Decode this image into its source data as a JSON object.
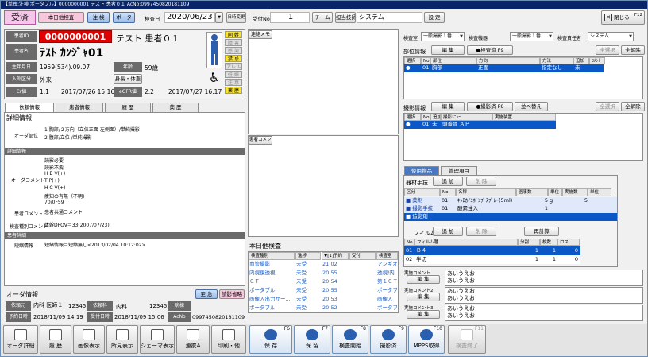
{
  "window": {
    "title": "【単独:注検 ポータブル】0000000001 テスト 患者０１ AcNo:0997450820181109"
  },
  "top": {
    "status": "受済",
    "mode": "本日他検査",
    "btn_chuken": "注 検",
    "btn_portable": "ポータ",
    "exam_date_label": "検査日",
    "exam_date": "2020/06/23",
    "date_change": "日時変更",
    "reception_label": "受付No",
    "reception_no": "1",
    "team": "チーム",
    "staff": "担当技師",
    "system": "システム",
    "settings": "設 定",
    "close": "閉じる",
    "close_key": "F12"
  },
  "patient": {
    "id_label": "患者ID",
    "id": "0000000001",
    "name_kanji": "テスト 患者０１",
    "name_label": "患者名",
    "name_kana": "ﾃｽﾄ ｶﾝｼﾞｬ01",
    "dob_label": "生年月日",
    "dob": "1959(S34).09.07",
    "age_label": "年齢",
    "age": "59歳",
    "admit_label": "入外区分",
    "admit": "外来",
    "body_btn": "身長・体重",
    "cr_label": "Cr値",
    "cr": "1.1",
    "cr_date": "2017/07/26 15:16",
    "egfr_label": "eGFR値",
    "egfr": "2.2",
    "egfr_date": "2017/07/27 16:17",
    "flags": [
      "同 姓",
      "障 害",
      "感 染",
      "禁 忌",
      "アレルギー",
      "妊 娠",
      "注 意",
      "薬 歴"
    ]
  },
  "tabs": {
    "t1": "依頼情報",
    "t2": "患者情報",
    "t3": "履 歴",
    "t4": "薬 歴"
  },
  "detail": {
    "title": "詳細情報",
    "order_site_label": "オーダ部位",
    "order_site_1": "1 胸部/２方向（立位正面-左側面）/単純撮影",
    "order_site_2": "2 腹部/立位 /単純撮影",
    "section1": "詳細情報",
    "order_comment_label": "オーダコメント",
    "order_comments": [
      "読影必要",
      "読影不要",
      "H B V(+)",
      "T P(+)",
      "H C V(+)",
      "痩知の有無（不明)",
      "70/0F59"
    ],
    "patient_comment_label": "患者コメント",
    "patient_comment": "患者共通コメント",
    "exam_comment_label": "検査種別コメント",
    "exam_comment": "体幹DFOV＝33(2007/07/23)",
    "section2": "患者詳細",
    "short_label": "短縮情報",
    "short_text": "短縮情報＝短縮無し<2013/02/04 10:12:02>"
  },
  "order_info": {
    "title": "オーダ情報",
    "urgent": "至 急",
    "reading": "読影省略",
    "req_dept_label": "依頼元",
    "req_dept": "内科 医師１",
    "req_doc_id": "12345",
    "req_ward_label": "依頼科",
    "req_ward": "内科",
    "req_ward_id": "12345",
    "ward_label": "病棟",
    "ward": "",
    "sched_label": "予約日時",
    "sched": "2018/11/09 14:19",
    "recv_label": "受付日時",
    "recv": "2018/11/09 15:06",
    "acno_label": "AcNo",
    "acno": "0997450820181109"
  },
  "middle": {
    "contact_memo": "連絡メモ",
    "patient_comment": "患者コメント",
    "other_exam_title": "本日他検査",
    "cols": [
      "検査種別",
      "進捗",
      "▼[1]予約",
      "受付",
      "検査室"
    ],
    "rows": [
      [
        "血管撮影",
        "未受",
        "21:02",
        "",
        "アンギオ"
      ],
      [
        "内視鏡透視",
        "未受",
        "20:55",
        "",
        "透視/内"
      ],
      [
        "ＣＴ",
        "未受",
        "20:54",
        "",
        "第１ＣＴ"
      ],
      [
        "ポータブル",
        "未受",
        "20:55",
        "",
        "ポータブ"
      ],
      [
        "画像入出力サー...",
        "未受",
        "20:53",
        "",
        "画像入"
      ],
      [
        "ポータブル",
        "未受",
        "20:52",
        "",
        "ポータブ"
      ]
    ]
  },
  "right": {
    "room_label": "検査室",
    "room": "一般撮影１番",
    "equip_label": "検査機器",
    "equip": "一般撮影１番",
    "resp_label": "検査責任者",
    "resp": "システム",
    "site_info": "部位情報",
    "edit": "編 集",
    "done": "●検査済 F9",
    "select_all": "全選択",
    "deselect_all": "全解除",
    "site_cols": [
      "選択",
      "No",
      "部位",
      "方向",
      "方法",
      "追加",
      "ｺﾒﾝﾄ"
    ],
    "site_row": [
      "●",
      "01",
      "胸部",
      "正面",
      "指定なし",
      "未",
      ""
    ],
    "shot_info": "撮影情報",
    "shot_done": "●撮影済 F9",
    "reorder": "並べ替え",
    "shot_cols": [
      "選択",
      "No",
      "追加",
      "撮影ﾒﾆｭｰ",
      "実施装置"
    ],
    "shot_row": [
      "●",
      "01",
      "未",
      "頭蓋骨 ＡＰ",
      ""
    ],
    "tab_goods": "使用物品",
    "tab_manage": "管理項目",
    "equip_material": "器材手技",
    "add": "追 加",
    "del": "削 除",
    "mat_cols": [
      "区分",
      "No",
      "名称",
      "医事数",
      "単位",
      "実施数",
      "単位"
    ],
    "mat_rows": [
      [
        "薬剤",
        "01",
        "ｷｼﾛｶｲﾝﾎﾟﾝﾌﾟｽﾌﾟﾚｰ(5ml)",
        "5",
        "g",
        "5",
        ""
      ],
      [
        "撮影手技",
        "01",
        "酸素注入",
        "1",
        "",
        "",
        ""
      ],
      [
        "造影剤",
        "",
        "",
        "",
        "",
        "",
        ""
      ]
    ],
    "film": "フィルム",
    "recalc": "再計算",
    "film_cols": [
      "No",
      "フィルム種",
      "分割",
      "枚数",
      "ロス"
    ],
    "film_rows": [
      [
        "01",
        "Ｂ４",
        "1",
        "1",
        "0"
      ],
      [
        "02",
        "半切",
        "1",
        "1",
        "0"
      ]
    ],
    "impl_comments": [
      {
        "label": "実施コメント",
        "text": "あいうえお\nあいうえお"
      },
      {
        "label": "実施コメント2",
        "text": "あいうえお\nあいうえお"
      },
      {
        "label": "実施コメント3",
        "text": "あいうえお\nあいうえお"
      }
    ]
  },
  "footer": {
    "b1": "オーダ詳細",
    "b2": "履 歴",
    "b3": "画像表示",
    "b4": "所見表示",
    "b5": "シェーマ表示",
    "b6": "連携A",
    "b7": "印刷・他",
    "save": "保 存",
    "save_key": "F6",
    "hold": "保 留",
    "hold_key": "F7",
    "start": "検査開始",
    "start_key": "F8",
    "shot": "撮影済",
    "shot_key": "F9",
    "mpps": "MPPS取得",
    "mpps_key": "F10",
    "end": "検査終了",
    "end_key": "F11"
  }
}
